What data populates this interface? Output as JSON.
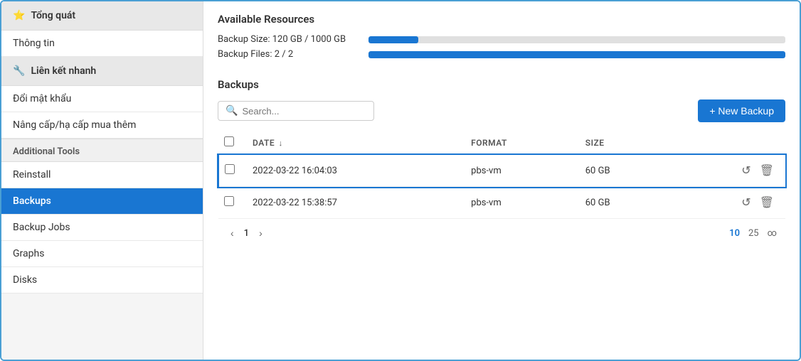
{
  "sidebar": {
    "sections": [
      {
        "type": "header",
        "icon": "⭐",
        "label": "Tổng quát"
      },
      {
        "type": "item",
        "label": "Thông tin",
        "active": false
      },
      {
        "type": "header",
        "icon": "🔧",
        "label": "Liên kết nhanh"
      },
      {
        "type": "item",
        "label": "Đổi mật khẩu",
        "active": false
      },
      {
        "type": "item",
        "label": "Nâng cấp/hạ cấp mua thêm",
        "active": false
      },
      {
        "type": "divider",
        "label": "Additional Tools"
      },
      {
        "type": "item",
        "label": "Reinstall",
        "active": false
      },
      {
        "type": "item",
        "label": "Backups",
        "active": true
      },
      {
        "type": "item",
        "label": "Backup Jobs",
        "active": false
      },
      {
        "type": "item",
        "label": "Graphs",
        "active": false
      },
      {
        "type": "item",
        "label": "Disks",
        "active": false
      }
    ]
  },
  "main": {
    "resources_title": "Available Resources",
    "resources": [
      {
        "label": "Backup Size: 120 GB / 1000 GB",
        "percent": 12
      },
      {
        "label": "Backup Files: 2 / 2",
        "percent": 100
      }
    ],
    "backups_title": "Backups",
    "search_placeholder": "Search...",
    "new_backup_label": "+ New Backup",
    "table": {
      "columns": [
        {
          "key": "checkbox",
          "label": ""
        },
        {
          "key": "date",
          "label": "DATE"
        },
        {
          "key": "format",
          "label": "FORMAT"
        },
        {
          "key": "size",
          "label": "SIZE"
        },
        {
          "key": "actions",
          "label": ""
        }
      ],
      "rows": [
        {
          "date": "2022-03-22 16:04:03",
          "format": "pbs-vm",
          "size": "60 GB",
          "highlighted": true
        },
        {
          "date": "2022-03-22 15:38:57",
          "format": "pbs-vm",
          "size": "60 GB",
          "highlighted": false
        }
      ]
    },
    "pagination": {
      "prev_label": "‹",
      "next_label": "›",
      "current_page": "1",
      "page_sizes": [
        "10",
        "25",
        "∞"
      ]
    }
  }
}
